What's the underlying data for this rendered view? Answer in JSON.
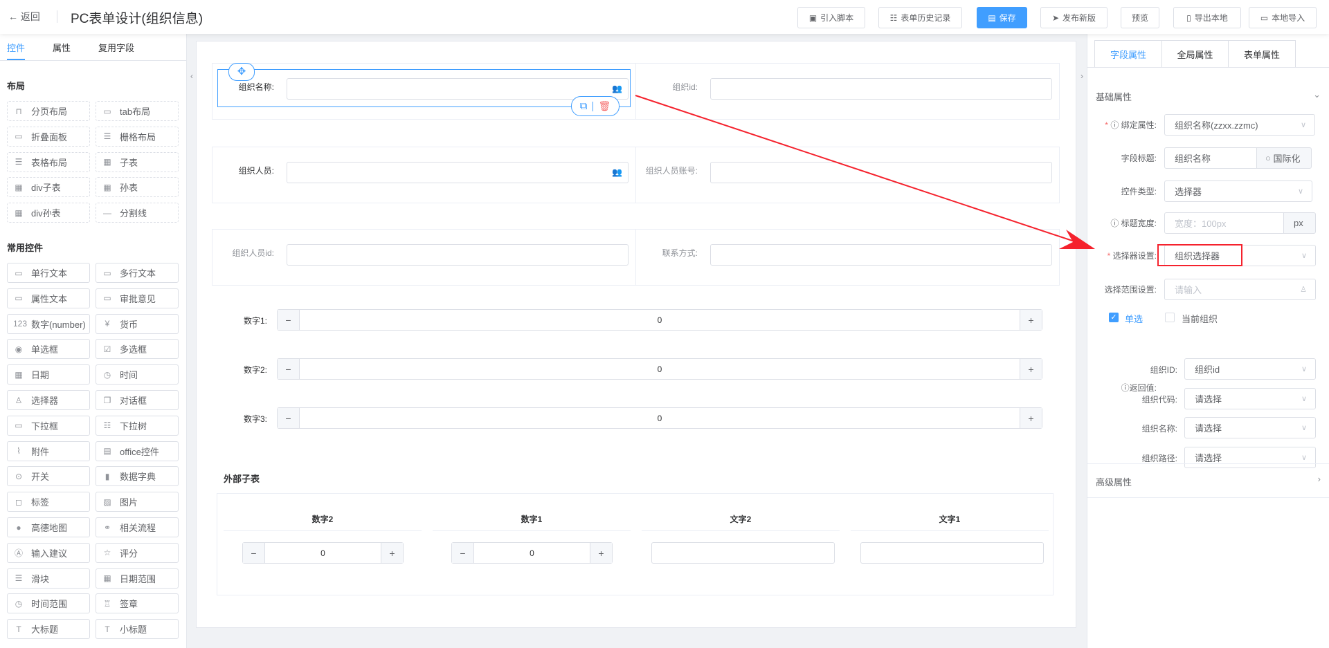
{
  "header": {
    "back": "返回",
    "title": "PC表单设计(组织信息)",
    "buttons": [
      {
        "label": "引入脚本",
        "icon": "script-icon"
      },
      {
        "label": "表单历史记录",
        "icon": "list-icon"
      },
      {
        "label": "保存",
        "icon": "save-icon"
      },
      {
        "label": "发布新版",
        "icon": "send-icon"
      },
      {
        "label": "预览",
        "icon": ""
      },
      {
        "label": "导出本地",
        "icon": "file-icon"
      },
      {
        "label": "本地导入",
        "icon": "folder-icon"
      }
    ]
  },
  "left": {
    "tabs": [
      "控件",
      "属性",
      "复用字段"
    ],
    "layout_title": "布局",
    "layout_items": [
      [
        "分页布局",
        "⊓"
      ],
      [
        "tab布局",
        "▭"
      ],
      [
        "折叠面板",
        "▭"
      ],
      [
        "栅格布局",
        "☰"
      ],
      [
        "表格布局",
        "☰"
      ],
      [
        "子表",
        "▦"
      ],
      [
        "div子表",
        "▦"
      ],
      [
        "孙表",
        "▦"
      ],
      [
        "div孙表",
        "▦"
      ],
      [
        "分割线",
        "—"
      ]
    ],
    "common_title": "常用控件",
    "common_items": [
      [
        "单行文本",
        "▭"
      ],
      [
        "多行文本",
        "▭"
      ],
      [
        "属性文本",
        "▭"
      ],
      [
        "审批意见",
        "▭"
      ],
      [
        "数字(number)",
        "123"
      ],
      [
        "货币",
        "¥"
      ],
      [
        "单选框",
        "◉"
      ],
      [
        "多选框",
        "☑"
      ],
      [
        "日期",
        "▦"
      ],
      [
        "时间",
        "◷"
      ],
      [
        "选择器",
        "♙"
      ],
      [
        "对话框",
        "❐"
      ],
      [
        "下拉框",
        "▭"
      ],
      [
        "下拉树",
        "☷"
      ],
      [
        "附件",
        "⌇"
      ],
      [
        "office控件",
        "▤"
      ],
      [
        "开关",
        "⊙"
      ],
      [
        "数据字典",
        "▮"
      ],
      [
        "标签",
        "◻"
      ],
      [
        "图片",
        "▨"
      ],
      [
        "高德地图",
        "●"
      ],
      [
        "相关流程",
        "⚭"
      ],
      [
        "输入建议",
        "Ⓐ"
      ],
      [
        "评分",
        "☆"
      ],
      [
        "滑块",
        "☰"
      ],
      [
        "日期范围",
        "▦"
      ],
      [
        "时间范围",
        "◷"
      ],
      [
        "签章",
        "♖"
      ],
      [
        "大标题",
        "T"
      ],
      [
        "小标题",
        "T"
      ]
    ]
  },
  "form": {
    "rows": [
      [
        {
          "label": "组织名称:",
          "icon": true
        },
        {
          "label": "组织id:",
          "icon": false
        }
      ],
      [
        {
          "label": "组织人员:",
          "icon": true
        },
        {
          "label": "组织人员账号:",
          "icon": false
        }
      ],
      [
        {
          "label": "组织人员id:",
          "icon": false
        },
        {
          "label": "联系方式:",
          "icon": false
        }
      ]
    ],
    "numbers": [
      {
        "label": "数字1:",
        "value": "0"
      },
      {
        "label": "数字2:",
        "value": "0"
      },
      {
        "label": "数字3:",
        "value": "0"
      }
    ],
    "subtable": {
      "title": "外部子表",
      "columns": [
        "数字2",
        "数字1",
        "文字2",
        "文字1"
      ],
      "values": [
        "0",
        "0",
        "",
        ""
      ]
    }
  },
  "right": {
    "tabs": [
      "字段属性",
      "全局属性",
      "表单属性"
    ],
    "basic_title": "基础属性",
    "advanced_title": "高级属性",
    "bind_label": "绑定属性:",
    "bind_value": "组织名称(zzxx.zzmc)",
    "field_title_label": "字段标题:",
    "field_title_value": "组织名称",
    "i18n": "国际化",
    "control_type_label": "控件类型:",
    "control_type_value": "选择器",
    "title_width_label": "标题宽度:",
    "title_width_placeholder": "宽度：100px",
    "unit": "px",
    "selector_label": "选择器设置:",
    "selector_value": "组织选择器",
    "range_label": "选择范围设置:",
    "range_placeholder": "请输入",
    "single": "单选",
    "current_org": "当前组织",
    "single_checked": true,
    "current_checked": false,
    "return_label": "返回值:",
    "returns": [
      {
        "label": "组织ID:",
        "value": "组织id"
      },
      {
        "label": "组织代码:",
        "value": "请选择"
      },
      {
        "label": "组织名称:",
        "value": "请选择"
      },
      {
        "label": "组织路径:",
        "value": "请选择"
      }
    ]
  },
  "colors": {
    "primary": "#409eff",
    "annotation": "#f5222d"
  }
}
